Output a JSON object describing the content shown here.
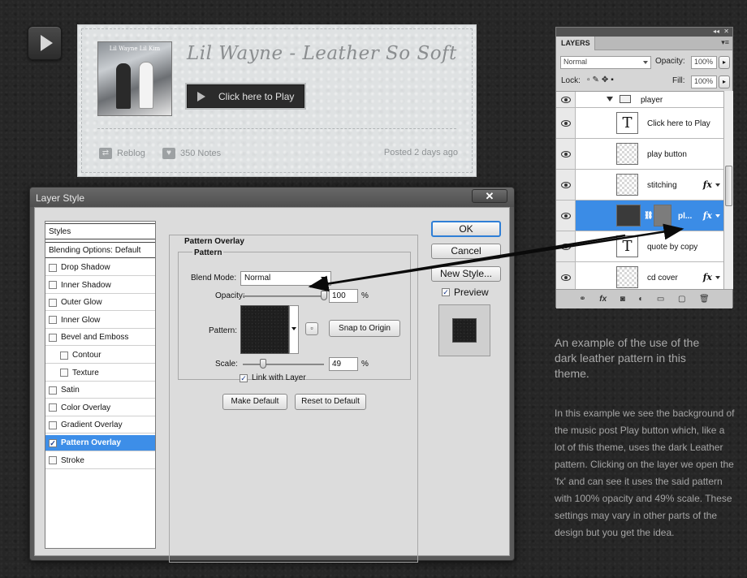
{
  "post": {
    "cd_cover_text": "Lil Wayne Lil Kim",
    "song_title": "Lil Wayne - Leather So Soft",
    "play_label": "Click here to Play",
    "reblog_label": "Reblog",
    "notes_label": "350 Notes",
    "posted_label": "Posted 2 days ago"
  },
  "dialog": {
    "title": "Layer Style",
    "close_label": "✕",
    "styles_header": "Styles",
    "blending_options": "Blending Options: Default",
    "effects": [
      {
        "label": "Drop Shadow",
        "checked": false,
        "indent": false
      },
      {
        "label": "Inner Shadow",
        "checked": false,
        "indent": false
      },
      {
        "label": "Outer Glow",
        "checked": false,
        "indent": false
      },
      {
        "label": "Inner Glow",
        "checked": false,
        "indent": false
      },
      {
        "label": "Bevel and Emboss",
        "checked": false,
        "indent": false
      },
      {
        "label": "Contour",
        "checked": false,
        "indent": true
      },
      {
        "label": "Texture",
        "checked": false,
        "indent": true
      },
      {
        "label": "Satin",
        "checked": false,
        "indent": false
      },
      {
        "label": "Color Overlay",
        "checked": false,
        "indent": false
      },
      {
        "label": "Gradient Overlay",
        "checked": false,
        "indent": false
      },
      {
        "label": "Pattern Overlay",
        "checked": true,
        "indent": false,
        "selected": true
      },
      {
        "label": "Stroke",
        "checked": false,
        "indent": false
      }
    ],
    "section_title": "Pattern Overlay",
    "group_title": "Pattern",
    "blend_mode_label": "Blend Mode:",
    "blend_mode_value": "Normal",
    "opacity_label": "Opacity:",
    "opacity_value": "100",
    "opacity_level": 1.0,
    "percent": "%",
    "pattern_label": "Pattern:",
    "snap_label": "Snap to Origin",
    "scale_label": "Scale:",
    "scale_value": "49",
    "scale_level": 0.49,
    "link_label": "Link with Layer",
    "make_default": "Make Default",
    "reset_default": "Reset to Default",
    "ok": "OK",
    "cancel": "Cancel",
    "new_style": "New Style...",
    "preview_label": "Preview"
  },
  "layers": {
    "tab": "LAYERS",
    "blend_mode": "Normal",
    "opacity_label": "Opacity:",
    "opacity_value": "100%",
    "lock_label": "Lock:",
    "fill_label": "Fill:",
    "fill_value": "100%",
    "rows": [
      {
        "name": "player",
        "type": "group"
      },
      {
        "name": "Click here to Play",
        "type": "text"
      },
      {
        "name": "play button",
        "type": "pixel"
      },
      {
        "name": "stitching",
        "type": "pixel",
        "fx": true
      },
      {
        "name": "pl...",
        "type": "shape",
        "fx": true,
        "selected": true
      },
      {
        "name": "quote by copy",
        "type": "text"
      },
      {
        "name": "cd cover",
        "type": "pixel",
        "fx": true
      }
    ]
  },
  "caption": "An example of the use of the dark leather pattern in this theme.",
  "description": "In this example we see the background of the music post Play button which, like a lot of this theme, uses the dark Leather pattern. Clicking on the layer we open the 'fx' and can see it uses the said pattern with 100% opacity and 49% scale. These settings may vary in other parts of the design but you get the idea."
}
